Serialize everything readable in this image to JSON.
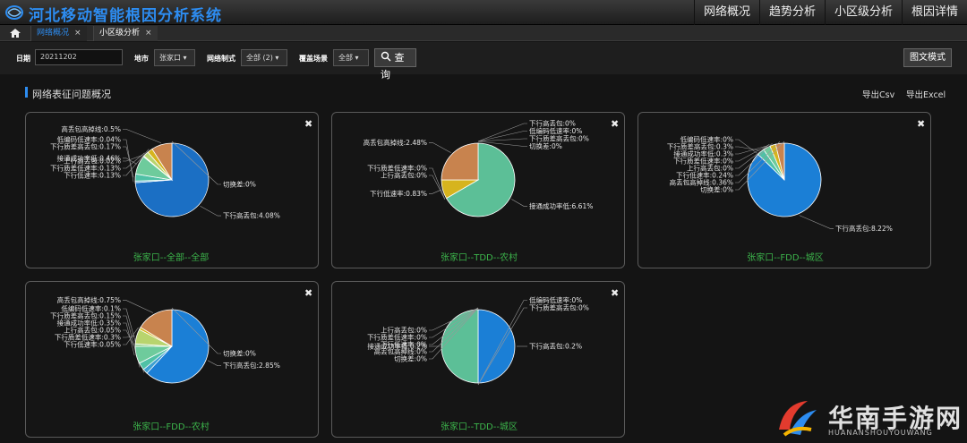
{
  "app_title": "河北移动智能根因分析系统",
  "nav": [
    "网络概况",
    "趋势分析",
    "小区级分析",
    "根因详情"
  ],
  "tabs": [
    {
      "label": "网络概况",
      "close": "×"
    },
    {
      "label": "小区级分析",
      "close": "×"
    }
  ],
  "filters": {
    "date_label": "日期",
    "date_value": "20211202",
    "city_label": "地市",
    "city_value": "张家口",
    "mode_label": "网络制式",
    "mode_value": "全部 (2)",
    "scene_label": "覆盖场景",
    "scene_value": "全部",
    "query_label": "查询",
    "view_label": "图文模式"
  },
  "section": {
    "title": "网络表征问题概况",
    "export_csv": "导出Csv",
    "export_excel": "导出Excel"
  },
  "close_icon": "✖",
  "colors": {
    "blue": "#1b6fc4",
    "green": "#5cbf97",
    "orange": "#c8834e",
    "lightgreen": "#90d08a",
    "yellow": "#d6b41e",
    "title_green": "#3cb44b",
    "accent": "#2d8cf0"
  },
  "chart_data": [
    {
      "type": "pie",
      "title": "张家口--全部--全部",
      "slices": [
        {
          "label": "下行高丢包:4.08%",
          "value": 4.08,
          "color": "#1b6fc4"
        },
        {
          "label": "低编码低速率:0.04%",
          "value": 0.04,
          "color": "#3ea0d0"
        },
        {
          "label": "下行质差高丢包:0.17%",
          "value": 0.17,
          "color": "#4fc1a6"
        },
        {
          "label": "接通成功率低:0.46%",
          "value": 0.46,
          "color": "#6ecb9c"
        },
        {
          "label": "上行高丢包:0.02%",
          "value": 0.02,
          "color": "#8fd18a"
        },
        {
          "label": "下行质差低速率:0.13%",
          "value": 0.13,
          "color": "#b8d46e"
        },
        {
          "label": "下行低速率:0.13%",
          "value": 0.13,
          "color": "#d6b41e"
        },
        {
          "label": "高丢包高掉线:0.5%",
          "value": 0.5,
          "color": "#c8834e"
        },
        {
          "label": "切换差:0%",
          "value": 0,
          "color": "#d9a070"
        }
      ]
    },
    {
      "type": "pie",
      "title": "张家口--TDD--农村",
      "slices": [
        {
          "label": "下行高丢包:0%",
          "value": 0,
          "color": "#1b6fc4"
        },
        {
          "label": "低编码低速率:0%",
          "value": 0,
          "color": "#3ea0d0"
        },
        {
          "label": "下行质差高丢包:0%",
          "value": 0,
          "color": "#4fc1a6"
        },
        {
          "label": "切换差:0%",
          "value": 0,
          "color": "#8fd18a"
        },
        {
          "label": "接通成功率低:6.61%",
          "value": 6.61,
          "color": "#5cbf97"
        },
        {
          "label": "下行质差低速率:0%",
          "value": 0,
          "color": "#b8d46e"
        },
        {
          "label": "上行高丢包:0%",
          "value": 0,
          "color": "#90d08a"
        },
        {
          "label": "下行低速率:0.83%",
          "value": 0.83,
          "color": "#d6b41e"
        },
        {
          "label": "高丢包高掉线:2.48%",
          "value": 2.48,
          "color": "#c8834e"
        }
      ]
    },
    {
      "type": "pie",
      "title": "张家口--FDD--城区",
      "slices": [
        {
          "label": "下行高丢包:8.22%",
          "value": 8.22,
          "color": "#1b7fd6"
        },
        {
          "label": "低编码低速率:0%",
          "value": 0,
          "color": "#3ea0d0"
        },
        {
          "label": "下行质差高丢包:0.3%",
          "value": 0.3,
          "color": "#4fc1a6"
        },
        {
          "label": "接通成功率低:0.3%",
          "value": 0.3,
          "color": "#6ecb9c"
        },
        {
          "label": "下行质差低速率:0%",
          "value": 0,
          "color": "#8fd18a"
        },
        {
          "label": "上行高丢包:0%",
          "value": 0,
          "color": "#b8d46e"
        },
        {
          "label": "下行低速率:0.24%",
          "value": 0.24,
          "color": "#d6b41e"
        },
        {
          "label": "高丢包高掉线:0.36%",
          "value": 0.36,
          "color": "#c8834e"
        },
        {
          "label": "切换差:0%",
          "value": 0,
          "color": "#d9a070"
        }
      ]
    },
    {
      "type": "pie",
      "title": "张家口--FDD--农村",
      "slices": [
        {
          "label": "下行高丢包:2.85%",
          "value": 2.85,
          "color": "#1b7fd6"
        },
        {
          "label": "低编码低速率:0.1%",
          "value": 0.1,
          "color": "#3ea0d0"
        },
        {
          "label": "下行质差高丢包:0.15%",
          "value": 0.15,
          "color": "#4fc1a6"
        },
        {
          "label": "接通成功率低:0.35%",
          "value": 0.35,
          "color": "#6ecb9c"
        },
        {
          "label": "上行高丢包:0.05%",
          "value": 0.05,
          "color": "#8fd18a"
        },
        {
          "label": "下行质差低速率:0.3%",
          "value": 0.3,
          "color": "#b8d46e"
        },
        {
          "label": "下行低速率:0.05%",
          "value": 0.05,
          "color": "#d6b41e"
        },
        {
          "label": "高丢包高掉线:0.75%",
          "value": 0.75,
          "color": "#c8834e"
        },
        {
          "label": "切换差:0%",
          "value": 0,
          "color": "#d9a070"
        }
      ]
    },
    {
      "type": "pie",
      "title": "张家口--TDD--城区",
      "slices": [
        {
          "label": "下行高丢包:0.2%",
          "value": 0.2,
          "color": "#1b7fd6"
        },
        {
          "label": "低编码低速率:0%",
          "value": 0,
          "color": "#3ea0d0"
        },
        {
          "label": "下行质差高丢包:0%",
          "value": 0,
          "color": "#4fc1a6"
        },
        {
          "label": "接通成功率低:0.2%",
          "value": 0.2,
          "color": "#5cbf97"
        },
        {
          "label": "上行高丢包:0%",
          "value": 0,
          "color": "#8fd18a"
        },
        {
          "label": "下行质差低速率:0%",
          "value": 0,
          "color": "#b8d46e"
        },
        {
          "label": "下行低速率:0%",
          "value": 0,
          "color": "#d6b41e"
        },
        {
          "label": "高丢包高掉线:0%",
          "value": 0,
          "color": "#c8834e"
        },
        {
          "label": "切换差:0%",
          "value": 0,
          "color": "#d9a070"
        }
      ]
    }
  ],
  "watermark": {
    "title": "华南手游网",
    "subtitle": "HUANANSHOUYOUWANG"
  }
}
